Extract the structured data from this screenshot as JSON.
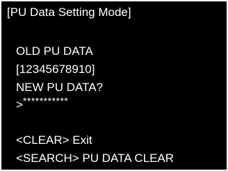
{
  "display": {
    "title": "[PU Data Setting Mode]",
    "old_label": "OLD PU DATA",
    "old_value": "[12345678910]",
    "new_label": "NEW PU DATA?",
    "prompt_symbol": ">",
    "masked_input": "***********",
    "clear_hint": "<CLEAR> Exit",
    "search_hint": "<SEARCH> PU DATA CLEAR"
  }
}
